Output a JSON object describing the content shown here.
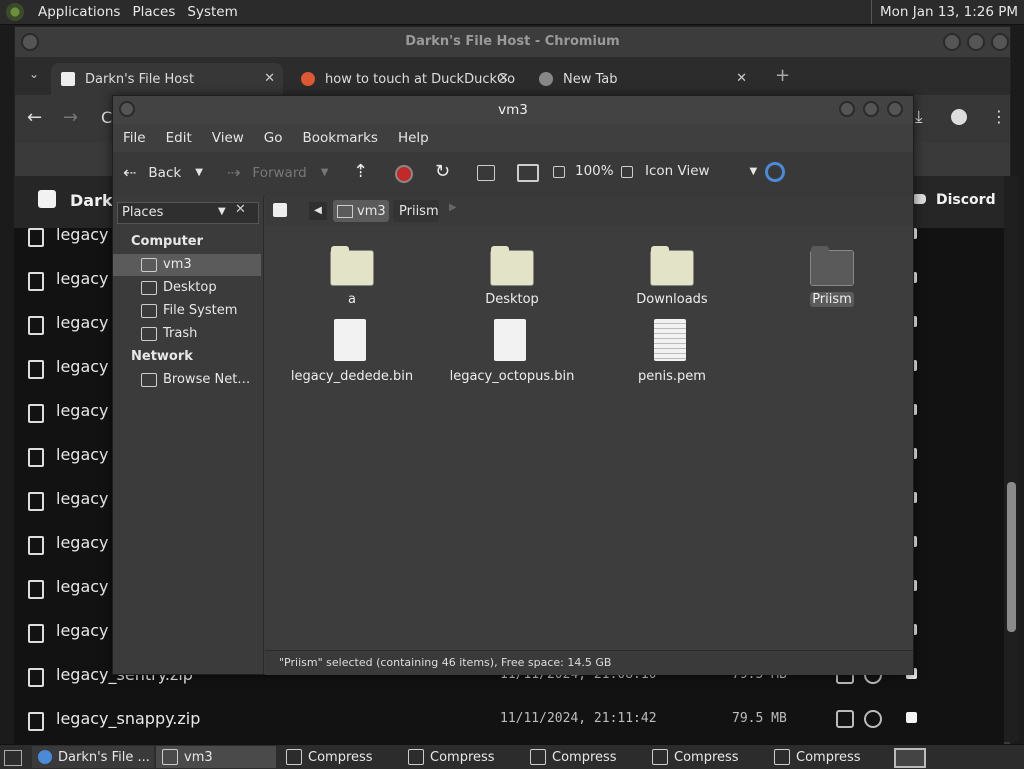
{
  "top_panel": {
    "menus": [
      "Applications",
      "Places",
      "System"
    ],
    "clock": "Mon Jan 13,  1:26 PM"
  },
  "chromium": {
    "title": "Darkn's File Host - Chromium",
    "tabs": [
      {
        "label": "Darkn's File Host"
      },
      {
        "label": "how to touch at DuckDuckGo"
      },
      {
        "label": "New Tab"
      }
    ],
    "new_tab": "+",
    "address_fragment": "C",
    "header": {
      "site_name": "Darkn",
      "discord_label": "Discord"
    },
    "rows": [
      {
        "name": "legacy",
        "date": "",
        "size": ""
      },
      {
        "name": "legacy",
        "date": "",
        "size": ""
      },
      {
        "name": "legacy",
        "date": "",
        "size": ""
      },
      {
        "name": "legacy",
        "date": "",
        "size": ""
      },
      {
        "name": "legacy",
        "date": "",
        "size": ""
      },
      {
        "name": "legacy",
        "date": "",
        "size": ""
      },
      {
        "name": "legacy",
        "date": "",
        "size": ""
      },
      {
        "name": "legacy",
        "date": "",
        "size": ""
      },
      {
        "name": "legacy",
        "date": "",
        "size": ""
      },
      {
        "name": "legacy",
        "date": "",
        "size": ""
      },
      {
        "name": "legacy_sentry.zip",
        "date": "11/11/2024, 21:08:10",
        "size": "79.5 MB"
      },
      {
        "name": "legacy_snappy.zip",
        "date": "11/11/2024, 21:11:42",
        "size": "79.5 MB"
      }
    ]
  },
  "file_manager": {
    "title": "vm3",
    "menus": [
      "File",
      "Edit",
      "View",
      "Go",
      "Bookmarks",
      "Help"
    ],
    "toolbar": {
      "back": "Back",
      "forward": "Forward",
      "zoom": "100%",
      "view_mode": "Icon View"
    },
    "sidebar": {
      "selector": "Places",
      "sections": [
        {
          "heading": "Computer",
          "items": [
            "vm3",
            "Desktop",
            "File System",
            "Trash"
          ]
        },
        {
          "heading": "Network",
          "items": [
            "Browse Net…"
          ]
        }
      ]
    },
    "path": [
      "vm3",
      "Priism"
    ],
    "items": [
      {
        "name": "a",
        "kind": "folder"
      },
      {
        "name": "Desktop",
        "kind": "folder"
      },
      {
        "name": "Downloads",
        "kind": "folder"
      },
      {
        "name": "Priism",
        "kind": "folder-selected"
      },
      {
        "name": "legacy_dedede.bin",
        "kind": "file"
      },
      {
        "name": "legacy_octopus.bin",
        "kind": "file"
      },
      {
        "name": "penis.pem",
        "kind": "text"
      }
    ],
    "status": "\"Priism\" selected (containing 46 items), Free space: 14.5 GB"
  },
  "taskbar": {
    "items": [
      "Darkn's File ...",
      "vm3",
      "Compress",
      "Compress",
      "Compress",
      "Compress",
      "Compress"
    ]
  },
  "colors": {
    "folder": "#e3e3c8",
    "folder_dark": "#5a5a5a",
    "selection": "#5b5b5b",
    "record_red": "#c22a2a"
  }
}
